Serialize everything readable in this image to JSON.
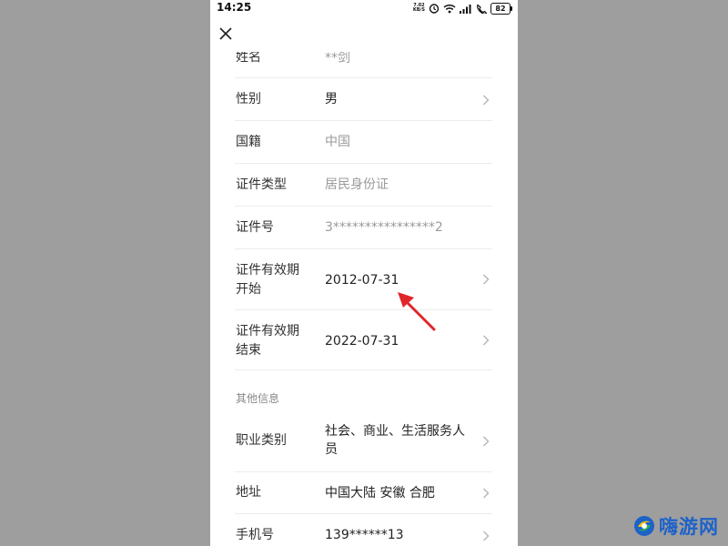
{
  "status_bar": {
    "time": "14:25",
    "net_speed_value": "7.02",
    "net_speed_unit": "KB/S",
    "battery": "82",
    "icons": [
      "alarm-icon",
      "wifi-icon",
      "signal-icon",
      "hd-call-icon",
      "battery-icon"
    ]
  },
  "header": {
    "close_icon": "close-icon"
  },
  "fields": [
    {
      "label": "姓名",
      "value": "**剑",
      "muted": true,
      "chevron": false
    },
    {
      "label": "性别",
      "value": "男",
      "muted": false,
      "chevron": true
    },
    {
      "label": "国籍",
      "value": "中国",
      "muted": true,
      "chevron": false
    },
    {
      "label": "证件类型",
      "value": "居民身份证",
      "muted": true,
      "chevron": false
    },
    {
      "label": "证件号",
      "value": "3****************2",
      "muted": true,
      "chevron": false
    },
    {
      "label": "证件有效期开始",
      "value": "2012-07-31",
      "muted": false,
      "chevron": true
    },
    {
      "label": "证件有效期结束",
      "value": "2022-07-31",
      "muted": false,
      "chevron": true
    }
  ],
  "section_other": {
    "title": "其他信息"
  },
  "other_fields": [
    {
      "label": "职业类别",
      "value": "社会、商业、生活服务人员",
      "muted": false,
      "chevron": true
    },
    {
      "label": "地址",
      "value": "中国大陆 安徽 合肥",
      "muted": false,
      "chevron": true
    },
    {
      "label": "手机号",
      "value": "139******13",
      "muted": false,
      "chevron": true
    }
  ],
  "annotation": {
    "arrow_color": "#e0262b"
  },
  "watermark": {
    "text": "嗨游网"
  }
}
